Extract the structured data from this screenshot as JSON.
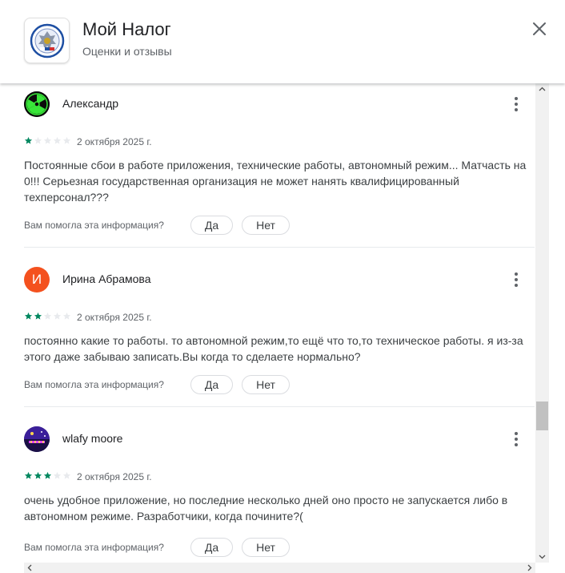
{
  "header": {
    "title": "Мой Налог",
    "subtitle": "Оценки и отзывы",
    "app_icon": "fns-emblem-icon",
    "close_icon": "close-icon"
  },
  "colors": {
    "star_filled": "#01875f",
    "star_empty": "#e8eaed",
    "avatar_irina": "#f4511e"
  },
  "reviews": [
    {
      "author": "Александр",
      "avatar_icon": "radiation-avatar",
      "rating": 1,
      "max_rating": 5,
      "date": "2 октября 2025 г.",
      "text": "Постоянные сбои в работе приложения, технические работы, автономный режим... Матчасть на 0!!! Серьезная государственная организация не может нанять квалифицированный техперсонал???",
      "helpful_question": "Вам помогла эта информация?",
      "yes_label": "Да",
      "no_label": "Нет"
    },
    {
      "author": "Ирина Абрамова",
      "avatar_letter": "И",
      "rating": 2,
      "max_rating": 5,
      "date": "2 октября 2025 г.",
      "text": "постоянно какие то работы. то автономной режим,то ещё что то,то техническое работы. я из-за этого даже забываю записать.Вы когда то сделаете нормально?",
      "helpful_question": "Вам помогла эта информация?",
      "yes_label": "Да",
      "no_label": "Нет"
    },
    {
      "author": "wlafy moore",
      "avatar_icon": "purple-scene-avatar",
      "rating": 3,
      "max_rating": 5,
      "date": "2 октября 2025 г.",
      "text": "очень удобное приложение, но последние несколько дней оно просто не запускается либо в автономном режиме. Разработчики, когда почините?(",
      "helpful_question": "Вам помогла эта информация?",
      "yes_label": "Да",
      "no_label": "Нет"
    }
  ]
}
